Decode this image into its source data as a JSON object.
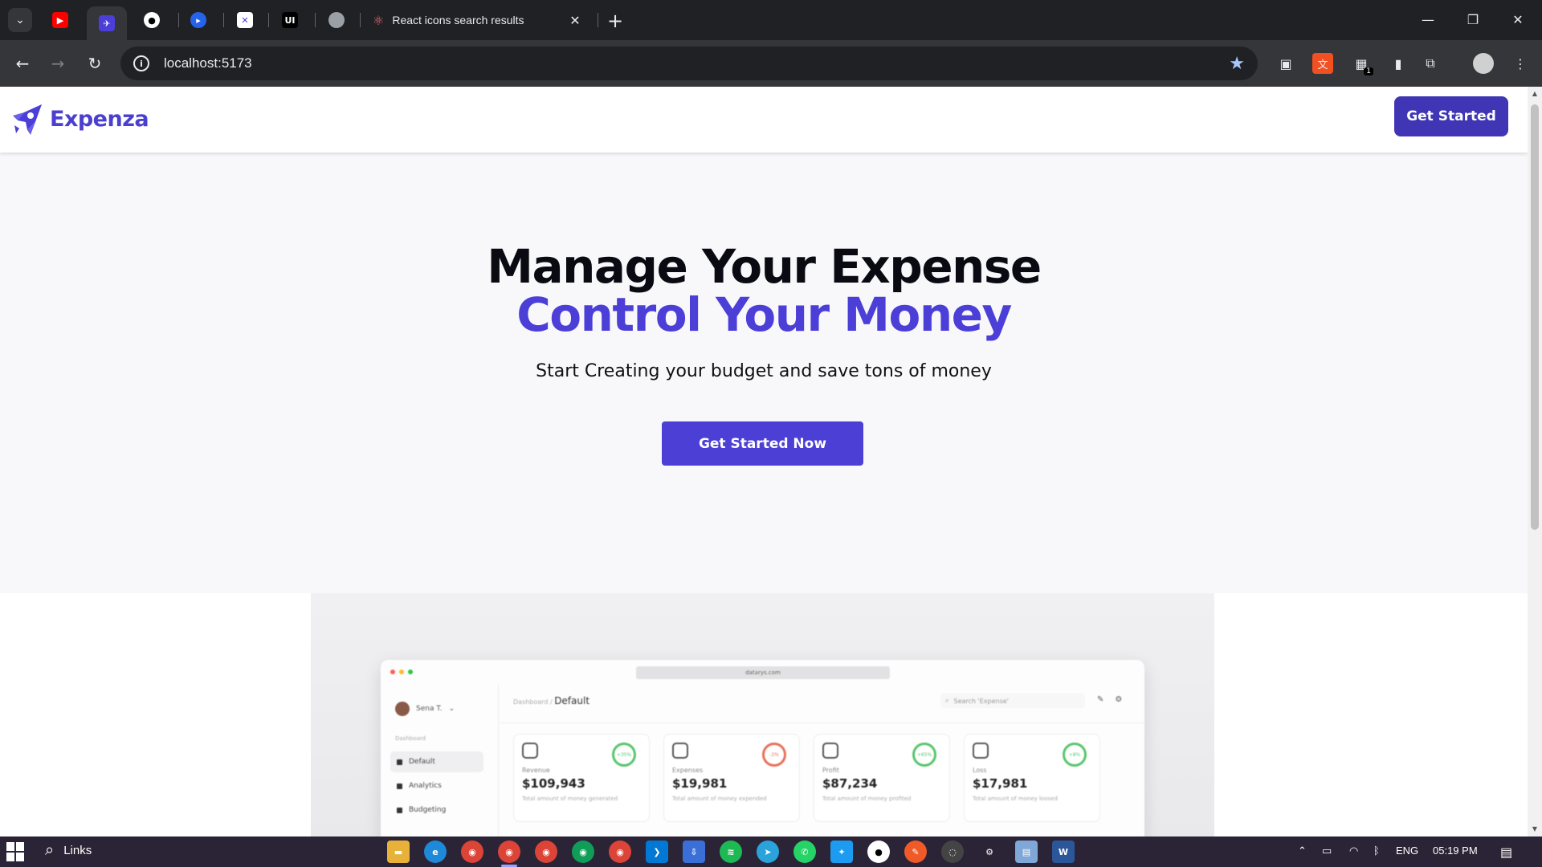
{
  "browser": {
    "active_tab_title": "React icons search results",
    "url": "localhost:5173",
    "pinned_tabs": [
      "youtube-favicon",
      "expenza-favicon",
      "github-favicon",
      "app-favicon",
      "x-favicon",
      "ui-favicon",
      "cloud-favicon"
    ],
    "ui_badge_text": "UI",
    "extension_badge": "1"
  },
  "site": {
    "brand": "Expenza",
    "header_button": "Get Started",
    "hero_line1": "Manage Your Expense",
    "hero_line2": "Control Your Money",
    "hero_subtitle": "Start Creating your budget and save tons of money",
    "hero_button": "Get Started Now",
    "accent_color": "#4b3fd8",
    "button_color": "#3f35b5"
  },
  "dashboard_preview": {
    "url": "datarys.com",
    "user": "Sena T.",
    "section_label": "Dashboard",
    "nav": [
      "Default",
      "Analytics",
      "Budgeting"
    ],
    "breadcrumb_parent": "Dashboard /",
    "breadcrumb_current": "Default",
    "search_placeholder": "Search 'Expense'",
    "cards": [
      {
        "label": "Revenue",
        "value": "$109,943",
        "desc": "Total amount of money generated",
        "badge": "+35%"
      },
      {
        "label": "Expenses",
        "value": "$19,981",
        "desc": "Total amount of money expended",
        "badge": "-2%"
      },
      {
        "label": "Profit",
        "value": "$87,234",
        "desc": "Total amount of money profited",
        "badge": "+65%"
      },
      {
        "label": "Loss",
        "value": "$17,981",
        "desc": "Total amount of money loosed",
        "badge": "+8%"
      }
    ]
  },
  "taskbar": {
    "search_label": "Links",
    "language": "ENG",
    "time": "05:19 PM"
  }
}
